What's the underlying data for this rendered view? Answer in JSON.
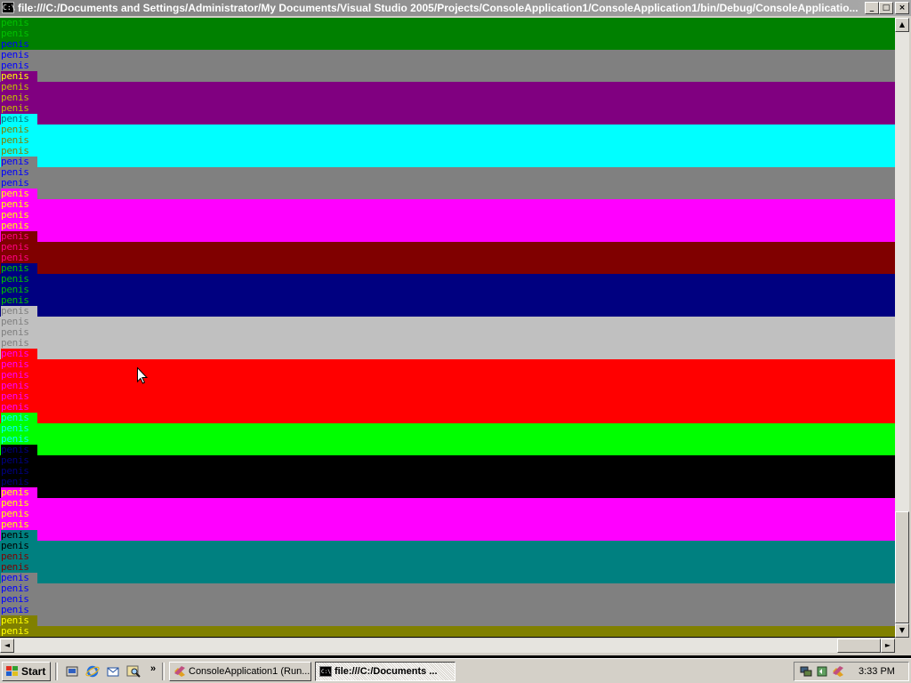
{
  "window": {
    "title": "file:///C:/Documents and Settings/Administrator/My Documents/Visual Studio 2005/Projects/ConsoleApplication1/ConsoleApplication1/bin/Debug/ConsoleApplicatio...",
    "icon": "console-icon",
    "controls": {
      "minimize": "_",
      "maximize": "□",
      "close": "×"
    }
  },
  "console": {
    "word": "penis",
    "bands": [
      {
        "bg": "#008000",
        "rows": [
          {
            "tbg": "#008000",
            "fg": "#00c000"
          },
          {
            "tbg": "#008000",
            "fg": "#00c000"
          },
          {
            "tbg": "#008000",
            "fg": "#0000ff"
          }
        ]
      },
      {
        "bg": "#808080",
        "rows": [
          {
            "tbg": "#808080",
            "fg": "#0000ff"
          },
          {
            "tbg": "#808080",
            "fg": "#0000ff"
          },
          {
            "tbg": "#800080",
            "fg": "#ffff00"
          }
        ]
      },
      {
        "bg": "#800080",
        "rows": [
          {
            "tbg": "#800080",
            "fg": "#c0c000"
          },
          {
            "tbg": "#800080",
            "fg": "#c0c000"
          },
          {
            "tbg": "#800080",
            "fg": "#c0c000"
          },
          {
            "tbg": "#00ffff",
            "fg": "#008080"
          }
        ]
      },
      {
        "bg": "#00ffff",
        "rows": [
          {
            "tbg": "#00ffff",
            "fg": "#808000"
          },
          {
            "tbg": "#00ffff",
            "fg": "#808000"
          },
          {
            "tbg": "#00ffff",
            "fg": "#808000"
          },
          {
            "tbg": "#808080",
            "fg": "#0000ff"
          }
        ]
      },
      {
        "bg": "#808080",
        "rows": [
          {
            "tbg": "#808080",
            "fg": "#0000ff"
          },
          {
            "tbg": "#808080",
            "fg": "#0000ff"
          },
          {
            "tbg": "#ff00ff",
            "fg": "#ffff00"
          }
        ]
      },
      {
        "bg": "#ff00ff",
        "rows": [
          {
            "tbg": "#ff00ff",
            "fg": "#ffff00"
          },
          {
            "tbg": "#ff00ff",
            "fg": "#ffff00"
          },
          {
            "tbg": "#ff00ff",
            "fg": "#ffff00"
          },
          {
            "tbg": "#800000",
            "fg": "#ff0080"
          }
        ]
      },
      {
        "bg": "#800000",
        "rows": [
          {
            "tbg": "#800000",
            "fg": "#ff0080"
          },
          {
            "tbg": "#800000",
            "fg": "#ff0080"
          },
          {
            "tbg": "#000080",
            "fg": "#00c000"
          }
        ]
      },
      {
        "bg": "#000080",
        "rows": [
          {
            "tbg": "#000080",
            "fg": "#00c000"
          },
          {
            "tbg": "#000080",
            "fg": "#00c000"
          },
          {
            "tbg": "#000080",
            "fg": "#00c000"
          },
          {
            "tbg": "#c0c0c0",
            "fg": "#808080"
          }
        ]
      },
      {
        "bg": "#c0c0c0",
        "rows": [
          {
            "tbg": "#c0c0c0",
            "fg": "#808080"
          },
          {
            "tbg": "#c0c0c0",
            "fg": "#808080"
          },
          {
            "tbg": "#c0c0c0",
            "fg": "#808080"
          },
          {
            "tbg": "#ff0000",
            "fg": "#ff00ff"
          }
        ]
      },
      {
        "bg": "#ff0000",
        "rows": [
          {
            "tbg": "#ff0000",
            "fg": "#ff00ff"
          },
          {
            "tbg": "#ff0000",
            "fg": "#ff00ff"
          },
          {
            "tbg": "#ff0000",
            "fg": "#ff00ff"
          },
          {
            "tbg": "#ff0000",
            "fg": "#ff00ff"
          },
          {
            "tbg": "#ff0000",
            "fg": "#ff00ff"
          },
          {
            "tbg": "#00ff00",
            "fg": "#00ffff"
          }
        ]
      },
      {
        "bg": "#00ff00",
        "rows": [
          {
            "tbg": "#00ff00",
            "fg": "#00ffff"
          },
          {
            "tbg": "#00ff00",
            "fg": "#00ffff"
          },
          {
            "tbg": "#000000",
            "fg": "#000080"
          }
        ]
      },
      {
        "bg": "#000000",
        "rows": [
          {
            "tbg": "#000000",
            "fg": "#000080"
          },
          {
            "tbg": "#000000",
            "fg": "#000080"
          },
          {
            "tbg": "#000000",
            "fg": "#000080"
          },
          {
            "tbg": "#ff00ff",
            "fg": "#ffff00"
          }
        ]
      },
      {
        "bg": "#ff00ff",
        "rows": [
          {
            "tbg": "#ff00ff",
            "fg": "#ffff00"
          },
          {
            "tbg": "#ff00ff",
            "fg": "#ffff00"
          },
          {
            "tbg": "#ff00ff",
            "fg": "#ffff00"
          },
          {
            "tbg": "#008080",
            "fg": "#000000"
          }
        ]
      },
      {
        "bg": "#008080",
        "rows": [
          {
            "tbg": "#008080",
            "fg": "#000000"
          },
          {
            "tbg": "#008080",
            "fg": "#800000"
          },
          {
            "tbg": "#008080",
            "fg": "#800000"
          },
          {
            "tbg": "#808080",
            "fg": "#0000ff"
          }
        ]
      },
      {
        "bg": "#808080",
        "rows": [
          {
            "tbg": "#808080",
            "fg": "#0000ff"
          },
          {
            "tbg": "#808080",
            "fg": "#0000ff"
          },
          {
            "tbg": "#808080",
            "fg": "#0000ff"
          },
          {
            "tbg": "#808000",
            "fg": "#ffff00"
          }
        ]
      },
      {
        "bg": "#808000",
        "rows": [
          {
            "tbg": "#808000",
            "fg": "#ffff00"
          }
        ]
      }
    ]
  },
  "scrollbars": {
    "vertical": {
      "position_fraction": 0.81,
      "thumb_fraction": 0.19,
      "up": "▲",
      "down": "▼"
    },
    "horizontal": {
      "position_fraction": 0.95,
      "thumb_fraction": 0.05,
      "left": "◄",
      "right": "►"
    }
  },
  "taskbar": {
    "start_label": "Start",
    "quick_launch": [
      "show-desktop-icon",
      "internet-explorer-icon",
      "outlook-express-icon",
      "search-icon"
    ],
    "chevron": "»",
    "tasks": [
      {
        "label": "ConsoleApplication1 (Run...",
        "icon": "visual-studio-icon",
        "active": false
      },
      {
        "label": "file:///C:/Documents ...",
        "icon": "console-icon",
        "active": true
      }
    ],
    "tray_icons": [
      "network-icon",
      "volume-icon",
      "app-tray-icon"
    ],
    "clock": "3:33 PM"
  },
  "colors": {
    "titlebar_inactive": "#808080",
    "chrome": "#d4d0c8"
  }
}
